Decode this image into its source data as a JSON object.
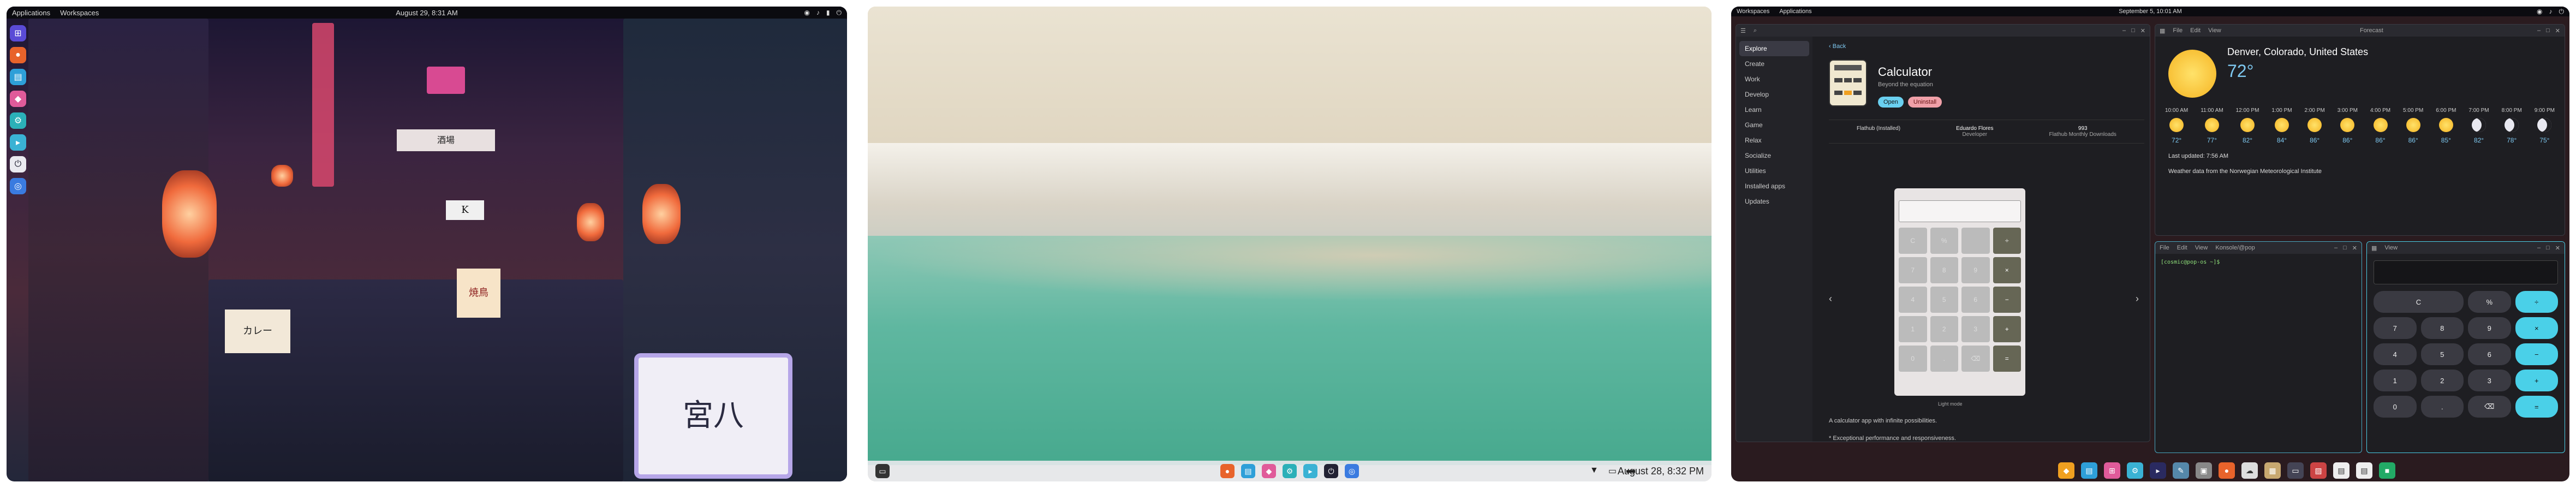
{
  "left_desktop": {
    "topbar": {
      "menu1": "Applications",
      "menu2": "Workspaces",
      "clock": "August 29, 8:31 AM"
    },
    "dock_icons": [
      "app-grid-icon",
      "firefox-icon",
      "files-icon",
      "store-icon",
      "settings-icon",
      "terminal-icon",
      "power-icon",
      "browser-icon"
    ],
    "signs": [
      "酒場",
      "カレー",
      "宮八",
      "焼鳥",
      "K"
    ]
  },
  "middle_desktop": {
    "taskbar": {
      "clock": "August 28, 8:32 PM",
      "apps": [
        "firefox-icon",
        "files-icon",
        "store-icon",
        "settings-icon",
        "terminal-icon",
        "power-icon",
        "browser-icon"
      ]
    }
  },
  "right_desktop": {
    "topbar": {
      "menu1": "Workspaces",
      "menu2": "Applications",
      "clock": "September 5, 10:01 AM"
    },
    "store": {
      "sidebar": [
        "Explore",
        "Create",
        "Work",
        "Develop",
        "Learn",
        "Game",
        "Relax",
        "Socialize",
        "Utilities",
        "Installed apps",
        "Updates"
      ],
      "back": "Back",
      "app_name": "Calculator",
      "tagline": "Beyond the equation",
      "open": "Open",
      "uninstall": "Uninstall",
      "stat1_title": "Flathub (Installed)",
      "stat2_title": "Eduardo Flores",
      "stat2_sub": "Developer",
      "stat3_title": "993",
      "stat3_sub": "Flathub Monthly Downloads",
      "mode_label": "Light mode",
      "desc1": "A calculator app with infinite possibilities.",
      "desc2": "* Exceptional performance and responsiveness."
    },
    "weather": {
      "window_title": "Forecast",
      "menus": [
        "File",
        "Edit",
        "View"
      ],
      "location": "Denver, Colorado, United States",
      "temp": "72°",
      "times": [
        "10:00 AM",
        "11:00 AM",
        "12:00 PM",
        "1:00 PM",
        "2:00 PM",
        "3:00 PM",
        "4:00 PM",
        "5:00 PM",
        "6:00 PM",
        "7:00 PM",
        "8:00 PM",
        "9:00 PM",
        "10:00 PM"
      ],
      "temps": [
        "72°",
        "77°",
        "82°",
        "84°",
        "86°",
        "86°",
        "86°",
        "86°",
        "85°",
        "82°",
        "78°",
        "75°"
      ],
      "updated": "Last updated: 7:56 AM",
      "credit": "Weather data from the Norwegian Meteorological Institute"
    },
    "terminal": {
      "menus": [
        "File",
        "Edit",
        "View",
        "Konsole/@pop"
      ],
      "prompt": "[cosmic@pop-os ~]$"
    },
    "calculator": {
      "menu": "View",
      "keys": [
        "C",
        "%",
        "÷",
        "7",
        "8",
        "9",
        "×",
        "4",
        "5",
        "6",
        "−",
        "1",
        "2",
        "3",
        "+",
        "0",
        ".",
        "⌫",
        "="
      ]
    }
  }
}
